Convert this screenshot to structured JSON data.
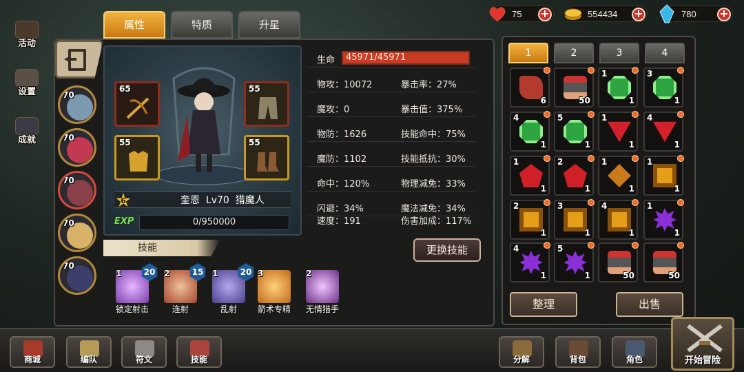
{
  "resources": [
    {
      "name": "stamina",
      "icon": "heart-icon",
      "value": "75"
    },
    {
      "name": "gold",
      "icon": "gold-coin-icon",
      "value": "554434"
    },
    {
      "name": "gems",
      "icon": "blue-crystal-icon",
      "value": "780"
    }
  ],
  "side_menu": [
    {
      "label": "活动",
      "icon": "event-icon"
    },
    {
      "label": "设置",
      "icon": "settings-icon"
    },
    {
      "label": "成就",
      "icon": "achievement-icon"
    }
  ],
  "tabs": [
    {
      "label": "属性",
      "active": true
    },
    {
      "label": "特质",
      "active": false
    },
    {
      "label": "升星",
      "active": false
    }
  ],
  "party": [
    {
      "level": "70",
      "color": "#7b9ab0"
    },
    {
      "level": "70",
      "color": "#c23a52"
    },
    {
      "level": "70",
      "color": "#8a4048"
    },
    {
      "level": "70",
      "color": "#d9b26a"
    },
    {
      "level": "70",
      "color": "#3b3f6a"
    }
  ],
  "equipment": {
    "top_left": {
      "level": "65",
      "icon": "crossbow-icon"
    },
    "top_right": {
      "level": "55",
      "icon": "pants-icon"
    },
    "bottom_left": {
      "level": "55",
      "icon": "armor-icon"
    },
    "bottom_right": {
      "level": "55",
      "icon": "boots-icon"
    }
  },
  "hero": {
    "star": "6",
    "name_line": "奎恩  Lv70  猎魔人",
    "exp_label": "EXP",
    "exp": "0/950000"
  },
  "stats": {
    "hp_label": "生命",
    "hp_value": "45971/45971",
    "rows": [
      {
        "l": "物攻：10072",
        "r": "暴击率：27%"
      },
      {
        "l": "魔攻：0",
        "r": "暴击值：375%"
      },
      {
        "l": "物防：1626",
        "r": "技能命中：75%"
      },
      {
        "l": "魔防：1102",
        "r": "技能抵抗：30%"
      },
      {
        "l": "命中：120%",
        "r": "物理减免：33%"
      },
      {
        "l": "闪避：34%",
        "r": "魔法减免：34%"
      },
      {
        "l": "速度：191",
        "r": "伤害加成：117%"
      }
    ]
  },
  "skills_title": "技能",
  "swap_skill_label": "更换技能",
  "skills": [
    {
      "level": "1",
      "cost": "20",
      "name": "锁定射击",
      "color": "#7a3fae"
    },
    {
      "level": "2",
      "cost": "15",
      "name": "连射",
      "color": "#a4452c"
    },
    {
      "level": "1",
      "cost": "20",
      "name": "乱射",
      "color": "#4a3f8a"
    },
    {
      "level": "3",
      "cost": "",
      "name": "箭术专精",
      "color": "#c06a1a"
    },
    {
      "level": "2",
      "cost": "",
      "name": "无情猎手",
      "color": "#6b2f86"
    }
  ],
  "inventory_tabs": [
    "1",
    "2",
    "3",
    "4"
  ],
  "inventory": [
    {
      "lv": "",
      "cnt": "6",
      "kind": "g-scroll",
      "icon": "scroll-icon"
    },
    {
      "lv": "",
      "cnt": "50",
      "kind": "g-drum",
      "icon": "meat-barrel-icon"
    },
    {
      "lv": "1",
      "cnt": "1",
      "kind": "g-green",
      "icon": "green-gem-icon"
    },
    {
      "lv": "3",
      "cnt": "1",
      "kind": "g-green",
      "icon": "green-gem-icon"
    },
    {
      "lv": "4",
      "cnt": "1",
      "kind": "g-green",
      "icon": "green-gem-icon"
    },
    {
      "lv": "5",
      "cnt": "1",
      "kind": "g-green",
      "icon": "green-gem-icon"
    },
    {
      "lv": "1",
      "cnt": "1",
      "kind": "g-redtri",
      "icon": "red-triangle-gem-icon"
    },
    {
      "lv": "4",
      "cnt": "1",
      "kind": "g-redtri",
      "icon": "red-triangle-gem-icon"
    },
    {
      "lv": "1",
      "cnt": "1",
      "kind": "g-redpent",
      "icon": "red-gem-icon"
    },
    {
      "lv": "2",
      "cnt": "1",
      "kind": "g-redpent",
      "icon": "red-gem-icon"
    },
    {
      "lv": "1",
      "cnt": "1",
      "kind": "g-amber",
      "icon": "amber-gem-icon"
    },
    {
      "lv": "1",
      "cnt": "1",
      "kind": "g-gold",
      "icon": "gold-gem-icon"
    },
    {
      "lv": "2",
      "cnt": "1",
      "kind": "g-gold",
      "icon": "gold-gem-icon"
    },
    {
      "lv": "3",
      "cnt": "1",
      "kind": "g-gold",
      "icon": "gold-gem-icon"
    },
    {
      "lv": "4",
      "cnt": "1",
      "kind": "g-gold",
      "icon": "gold-gem-icon"
    },
    {
      "lv": "1",
      "cnt": "1",
      "kind": "g-purple",
      "icon": "purple-gem-icon"
    },
    {
      "lv": "4",
      "cnt": "1",
      "kind": "g-purple",
      "icon": "purple-gem-icon"
    },
    {
      "lv": "5",
      "cnt": "1",
      "kind": "g-purple",
      "icon": "purple-gem-icon"
    },
    {
      "lv": "",
      "cnt": "50",
      "kind": "g-drum",
      "icon": "meat-barrel-icon"
    },
    {
      "lv": "",
      "cnt": "50",
      "kind": "g-drum",
      "icon": "meat-barrel-icon"
    }
  ],
  "inventory_buttons": {
    "sort": "整理",
    "sell": "出售"
  },
  "bottom_nav": [
    {
      "label": "商城",
      "icon": "shop-icon",
      "color": "#a83a2c"
    },
    {
      "label": "编队",
      "icon": "formation-icon",
      "color": "#b59a58"
    },
    {
      "label": "符文",
      "icon": "rune-icon",
      "color": "#8d8a84"
    },
    {
      "label": "技能",
      "icon": "skill-book-icon",
      "color": "#a9453a"
    },
    {
      "label": "分解",
      "icon": "decompose-icon",
      "color": "#8a6a3a"
    },
    {
      "label": "背包",
      "icon": "bag-icon",
      "color": "#6b4a36"
    },
    {
      "label": "角色",
      "icon": "character-icon",
      "color": "#4a5870"
    }
  ],
  "adventure_label": "开始冒险",
  "colors": {
    "accent": "#f2b33e",
    "hp": "#c83b22",
    "exp_green": "#7fe04e"
  }
}
